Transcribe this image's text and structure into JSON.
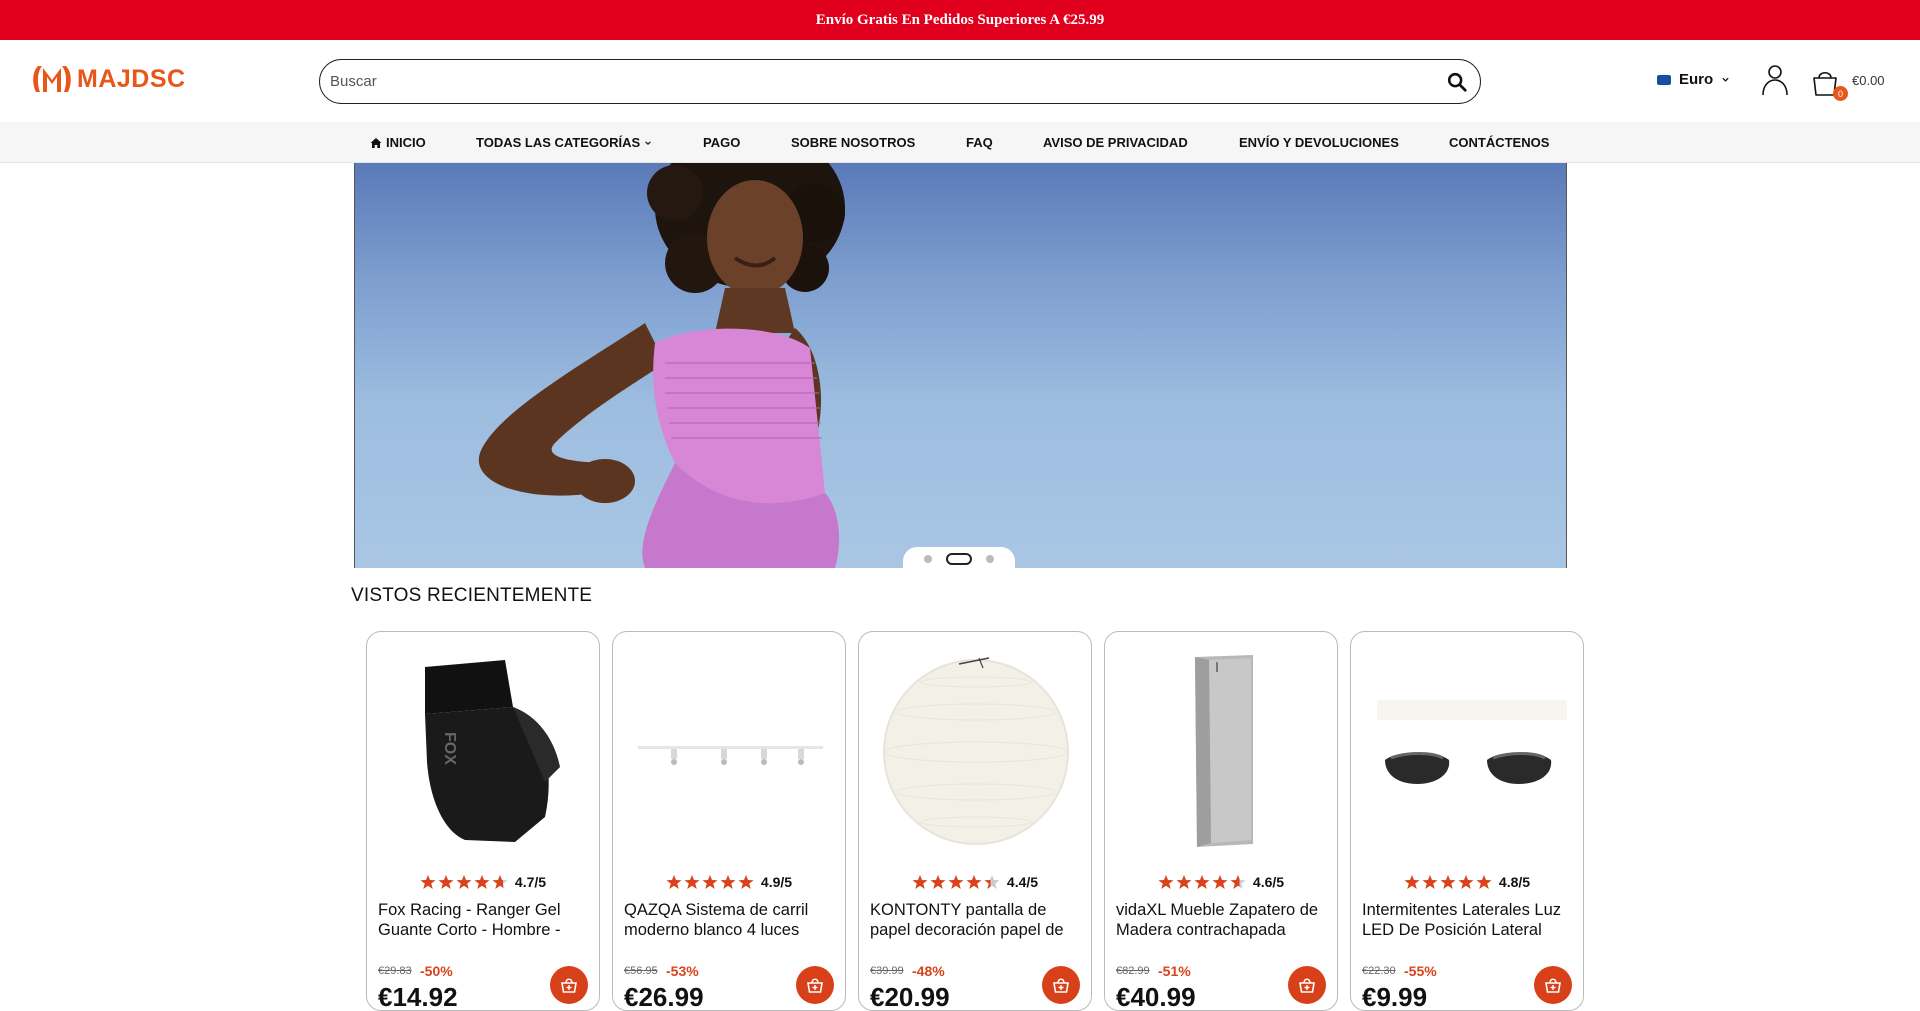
{
  "topbar": {
    "text": "Envío Gratis En Pedidos Superiores A €25.99"
  },
  "logo": {
    "text": "MAJDSC",
    "color": "#e8561a"
  },
  "search": {
    "placeholder": "Buscar"
  },
  "currency": {
    "label": "Euro"
  },
  "cart": {
    "count": "0",
    "total": "€0.00"
  },
  "nav": {
    "items": [
      {
        "label": "INICIO"
      },
      {
        "label": "TODAS LAS CATEGORÍAS"
      },
      {
        "label": "PAGO"
      },
      {
        "label": "SOBRE NOSOTROS"
      },
      {
        "label": "FAQ"
      },
      {
        "label": "AVISO DE PRIVACIDAD"
      },
      {
        "label": "ENVÍO Y DEVOLUCIONES"
      },
      {
        "label": "CONTÁCTENOS"
      }
    ]
  },
  "slider": {
    "active_index": 1,
    "count": 3
  },
  "recent": {
    "title": "VISTOS RECIENTEMENTE",
    "products": [
      {
        "rating": 4.7,
        "rating_text": "4.7/5",
        "title": "Fox Racing - Ranger Gel Guante Corto - Hombre - Negro",
        "old_price": "€29.83",
        "discount": "-50%",
        "price": "€14.92",
        "image": "glove"
      },
      {
        "rating": 4.9,
        "rating_text": "4.9/5",
        "title": "QAZQA Sistema de carril moderno blanco 4 luces",
        "old_price": "€56.95",
        "discount": "-53%",
        "price": "€26.99",
        "image": "track-light"
      },
      {
        "rating": 4.4,
        "rating_text": "4.4/5",
        "title": "KONTONTY pantalla de papel decoración papel de arroz",
        "old_price": "€39.99",
        "discount": "-48%",
        "price": "€20.99",
        "image": "paper-lamp"
      },
      {
        "rating": 4.6,
        "rating_text": "4.6/5",
        "title": "vidaXL Mueble Zapatero de Madera contrachapada",
        "old_price": "€82.99",
        "discount": "-51%",
        "price": "€40.99",
        "image": "shoe-cabinet"
      },
      {
        "rating": 4.8,
        "rating_text": "4.8/5",
        "title": "Intermitentes Laterales Luz LED De Posición Lateral",
        "old_price": "€22.30",
        "discount": "-55%",
        "price": "€9.99",
        "image": "indicators"
      }
    ]
  },
  "colors": {
    "accent": "#e0001e",
    "brand_orange": "#d8401a",
    "star": "#d9421b"
  }
}
